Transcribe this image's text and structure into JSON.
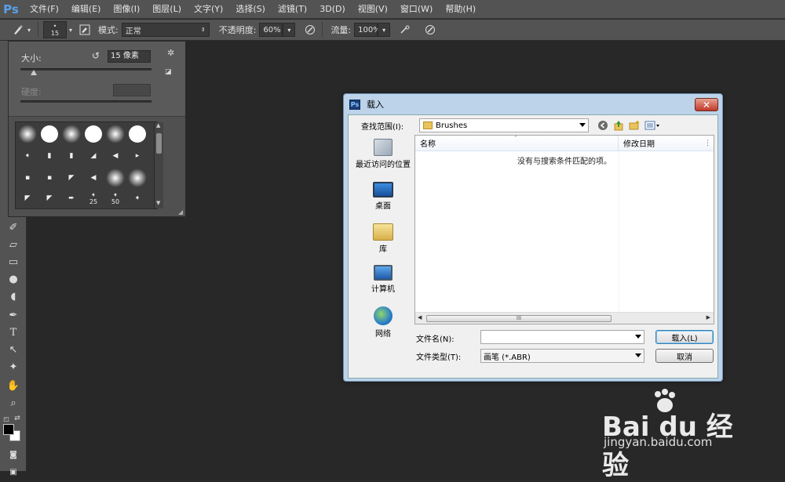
{
  "app": {
    "logo": "Ps"
  },
  "menu": [
    "文件(F)",
    "编辑(E)",
    "图像(I)",
    "图层(L)",
    "文字(Y)",
    "选择(S)",
    "滤镜(T)",
    "3D(D)",
    "视图(V)",
    "窗口(W)",
    "帮助(H)"
  ],
  "options": {
    "brush_size": "15",
    "mode_label": "模式:",
    "mode_value": "正常",
    "opacity_label": "不透明度:",
    "opacity_value": "60%",
    "flow_label": "流量:",
    "flow_value": "100%"
  },
  "brush_panel": {
    "size_label": "大小:",
    "size_value": "15 像素",
    "hardness_label": "硬度:",
    "size_slider_level": 0.1,
    "tip_labels": [
      "25",
      "50"
    ]
  },
  "dialog": {
    "title": "载入",
    "icon_text": "Ps",
    "close_glyph": "✕",
    "look_in_label": "查找范围(I):",
    "look_in_value": "Brushes",
    "places": [
      "最近访问的位置",
      "桌面",
      "库",
      "计算机",
      "网络"
    ],
    "columns": [
      "名称",
      "修改日期"
    ],
    "empty_message": "没有与搜索条件匹配的项。",
    "filename_label": "文件名(N):",
    "filename_value": "",
    "filetype_label": "文件类型(T):",
    "filetype_value": "画笔 (*.ABR)",
    "load_button": "载入(L)",
    "cancel_button": "取消",
    "scroll_grip": "III"
  },
  "watermark": {
    "brand": "Bai du 经验",
    "url": "jingyan.baidu.com"
  },
  "colors": {
    "ps_blue": "#5aa0e6",
    "dialog_frame": "#bcd3ea",
    "canvas": "#282828"
  }
}
